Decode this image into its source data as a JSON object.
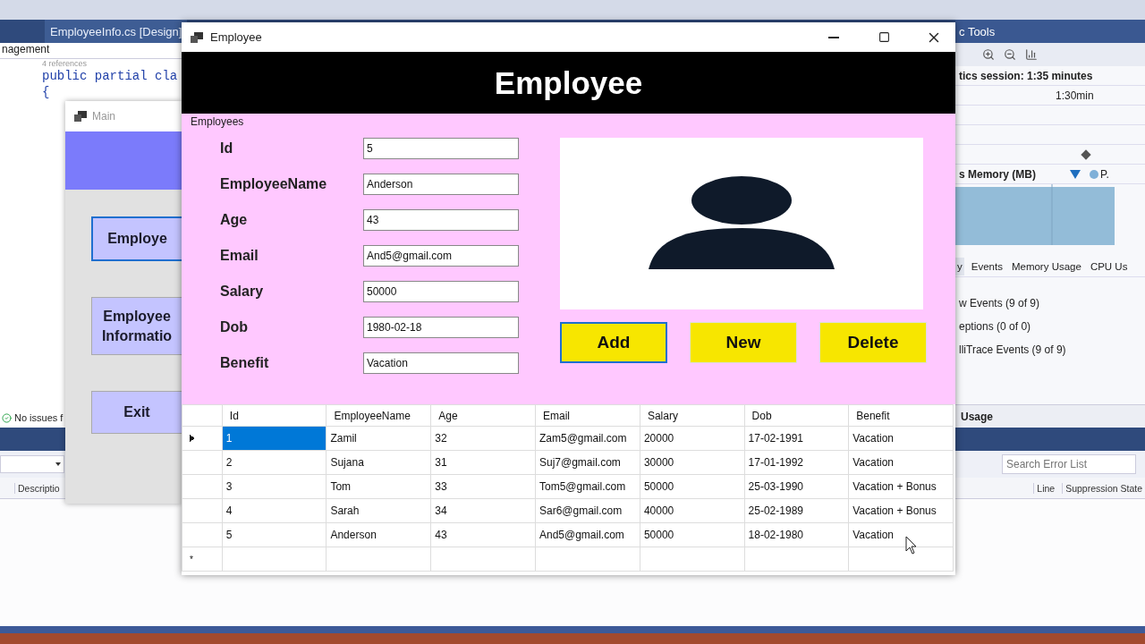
{
  "ide": {
    "doc_tab": {
      "label": "EmployeeInfo.cs [Design]",
      "selected": true
    },
    "breadcrumb": "nagement",
    "code": {
      "references": "4 references",
      "lines": [
        "public partial cla",
        "{"
      ]
    },
    "status": "No issues f",
    "diagnostics": {
      "title": "c Tools",
      "session": "tics session: 1:35 minutes",
      "ruler": "1:30min",
      "memory_label": "s Memory (MB)",
      "legend": "P.",
      "tabs": [
        {
          "label": "y",
          "selected": true
        },
        {
          "label": "Events",
          "selected": false
        },
        {
          "label": "Memory Usage",
          "selected": false
        },
        {
          "label": "CPU Us",
          "selected": false
        }
      ],
      "events": [
        "w Events (9 of 9)",
        "eptions (0 of 0)",
        "lliTrace Events (9 of 9)"
      ],
      "usage": "Usage"
    },
    "error_list": {
      "search": {
        "placeholder": "Search Error List"
      },
      "columns": [
        "Descriptio",
        "Line",
        "Suppression State"
      ]
    }
  },
  "main_window": {
    "title": "Main",
    "buttons": [
      {
        "lines": [
          "Employe"
        ],
        "focused": true
      },
      {
        "lines": [
          "Employee",
          "Informatio"
        ],
        "focused": false
      },
      {
        "lines": [
          "Exit"
        ],
        "focused": false
      }
    ]
  },
  "employee_window": {
    "title": "Employee",
    "header": "Employee",
    "group": "Employees",
    "fields": [
      {
        "label": "Id",
        "value": "5"
      },
      {
        "label": "EmployeeName",
        "value": "Anderson"
      },
      {
        "label": "Age",
        "value": "43"
      },
      {
        "label": "Email",
        "value": "And5@gmail.com"
      },
      {
        "label": "Salary",
        "value": "50000"
      },
      {
        "label": "Dob",
        "value": "1980-02-18"
      },
      {
        "label": "Benefit",
        "value": "Vacation"
      }
    ],
    "buttons": [
      {
        "label": "Add",
        "focused": true
      },
      {
        "label": "New",
        "focused": false
      },
      {
        "label": "Delete",
        "focused": false
      }
    ],
    "grid": {
      "columns": [
        "Id",
        "EmployeeName",
        "Age",
        "Email",
        "Salary",
        "Dob",
        "Benefit"
      ],
      "rows": [
        {
          "cells": [
            "1",
            "Zamil",
            "32",
            "Zam5@gmail.com",
            "20000",
            "17-02-1991",
            "Vacation"
          ],
          "current": true
        },
        {
          "cells": [
            "2",
            "Sujana",
            "31",
            "Suj7@gmail.com",
            "30000",
            "17-01-1992",
            "Vacation"
          ],
          "current": false
        },
        {
          "cells": [
            "3",
            "Tom",
            "33",
            "Tom5@gmail.com",
            "50000",
            "25-03-1990",
            "Vacation + Bonus"
          ],
          "current": false
        },
        {
          "cells": [
            "4",
            "Sarah",
            "34",
            "Sar6@gmail.com",
            "40000",
            "25-02-1989",
            "Vacation + Bonus"
          ],
          "current": false
        },
        {
          "cells": [
            "5",
            "Anderson",
            "43",
            "And5@gmail.com",
            "50000",
            "18-02-1980",
            "Vacation"
          ],
          "current": false
        }
      ],
      "new_row_marker": "*"
    }
  }
}
